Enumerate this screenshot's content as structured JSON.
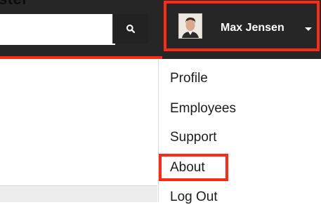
{
  "header": {
    "top_caption": "ster",
    "search": {
      "value": "",
      "placeholder": ""
    },
    "user": {
      "name": "Max Jensen"
    }
  },
  "user_menu": {
    "items": [
      {
        "label": "Profile"
      },
      {
        "label": "Employees"
      },
      {
        "label": "Support"
      },
      {
        "label": "About"
      },
      {
        "label": "Log Out"
      }
    ]
  },
  "icons": {
    "search": "search-icon",
    "caret": "chevron-down-icon",
    "avatar": "user-avatar"
  },
  "colors": {
    "header_bg": "#262626",
    "highlight": "#ff2a14",
    "menu_text": "#1d1d1d",
    "user_text": "#ffffff"
  }
}
